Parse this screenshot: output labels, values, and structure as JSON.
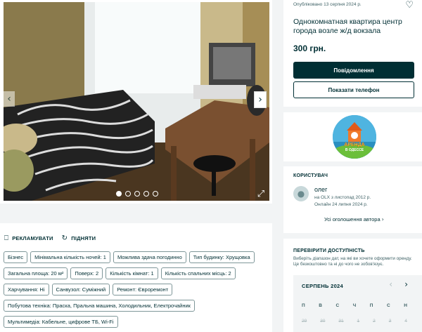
{
  "gallery": {
    "photo_count": 5,
    "active_index": 0
  },
  "actions": {
    "promote": "РЕКЛАМУВАТИ",
    "raise": "ПІДНЯТИ"
  },
  "tags": [
    "Бізнес",
    "Мінімальна кількість ночей: 1",
    "Можлива здача погодинно",
    "Тип будинку: Хрущовка",
    "Загальна площа: 20 м²",
    "Поверх: 2",
    "Кількість кімнат: 1",
    "Кількість спальних місць: 2",
    "Харчування: Ні",
    "Санвузол: Суміжний",
    "Ремонт: Євроремонт",
    "Побутова техніка: Праска, Пральна машина, Холодильник, Електрочайник",
    "Мультимедіа: Кабельне, цифрове ТБ, Wi-Fi"
  ],
  "listing": {
    "published": "Опубліковано 13 серпня 2024 р.",
    "title": "Однокомнатная квартира центр города возле ж/д вокзала",
    "price": "300 грн.",
    "message_button": "Повідомлення",
    "phone_button": "Показати телефон"
  },
  "logo": {
    "text": "АРЕНДА В ОДЕССЕ"
  },
  "user": {
    "section_title": "КОРИСТУВАЧ",
    "name": "олег",
    "since": "на OLX з листопад 2012 р.",
    "online": "Онлайн 24 липня 2024 р.",
    "all_ads": "Усі оголошення автора"
  },
  "availability": {
    "section_title": "ПЕРЕВІРИТИ ДОСТУПНІСТЬ",
    "description": "Виберіть діапазон дат, на які ви хочете оформити оренду. Це безкоштовно та ні до чого не зобов'язує.",
    "month": "СЕРПЕНЬ 2024",
    "weekdays": [
      "П",
      "В",
      "С",
      "Ч",
      "П",
      "С",
      "Н"
    ],
    "days": [
      "29",
      "30",
      "31",
      "1",
      "2",
      "3",
      "4"
    ]
  },
  "colors": {
    "primary": "#002f34",
    "background": "#f2f4f5",
    "muted": "#406367"
  }
}
